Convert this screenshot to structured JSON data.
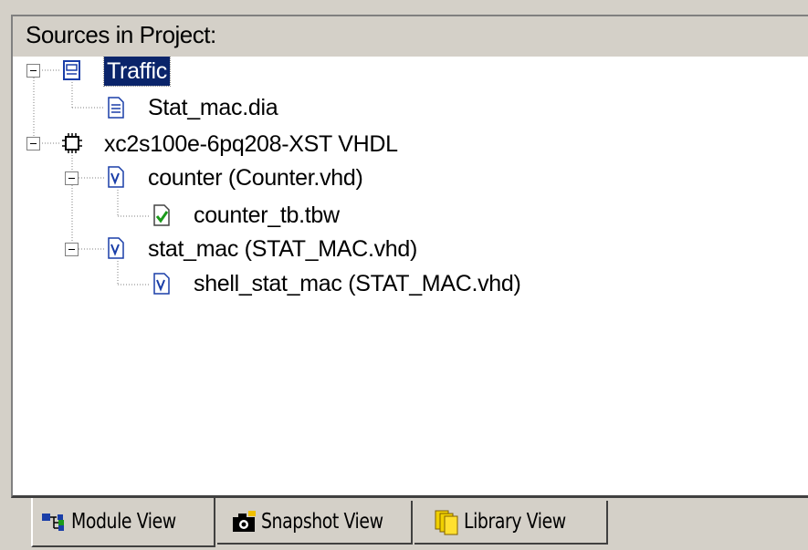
{
  "panel": {
    "title": "Sources in Project:"
  },
  "tree": {
    "project": {
      "label": "Traffic",
      "selected": true,
      "expanded": true,
      "children": [
        {
          "label": "Stat_mac.dia",
          "icon": "document-icon"
        }
      ]
    },
    "device": {
      "label": "xc2s100e-6pq208-XST VHDL",
      "expanded": true,
      "icon": "chip-icon"
    },
    "modules": [
      {
        "label": "counter (Counter.vhd)",
        "icon": "vhdl-file-icon",
        "expanded": true,
        "children": [
          {
            "label": "counter_tb.tbw",
            "icon": "testbench-check-icon"
          }
        ]
      },
      {
        "label": "stat_mac (STAT_MAC.vhd)",
        "icon": "vhdl-file-icon",
        "expanded": true,
        "children": [
          {
            "label": "shell_stat_mac (STAT_MAC.vhd)",
            "icon": "vhdl-file-icon"
          }
        ]
      }
    ]
  },
  "tabs": [
    {
      "label": "Module View",
      "icon": "module-hierarchy-icon",
      "active": true
    },
    {
      "label": "Snapshot View",
      "icon": "camera-icon",
      "active": false
    },
    {
      "label": "Library View",
      "icon": "library-books-icon",
      "active": false
    }
  ],
  "colors": {
    "selection": "#0a246a",
    "window_bg": "#d4d0c8",
    "check_green": "#1a9a1a",
    "vhdl_blue": "#1a3ea8"
  }
}
